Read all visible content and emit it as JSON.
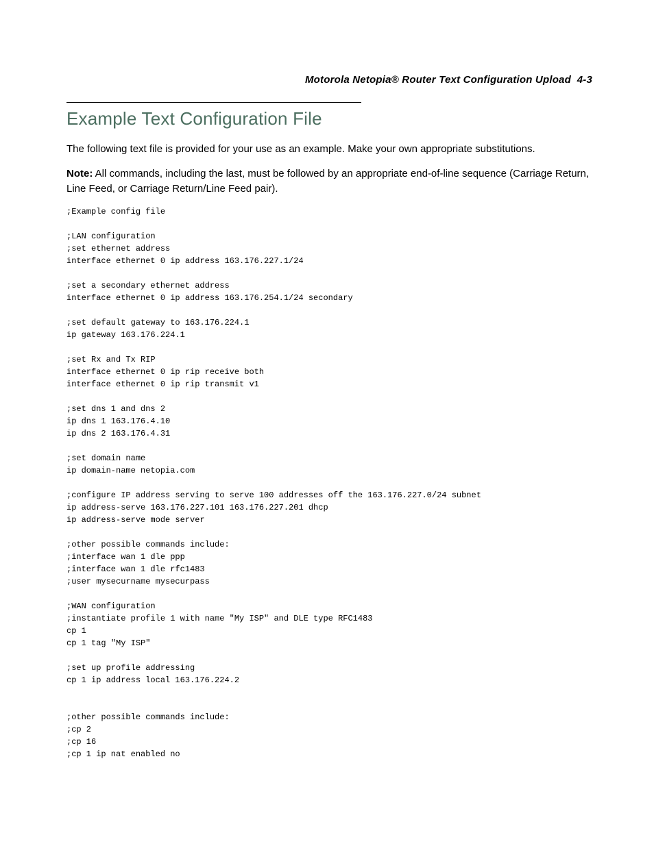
{
  "header": {
    "running_title": "Motorola Netopia® Router Text Configuration Upload",
    "page_label": "4-3"
  },
  "section": {
    "heading": "Example Text Configuration File",
    "intro": "The following text file is provided for your use as an example. Make your own appropriate substitutions.",
    "note_label": "Note:",
    "note_body": " All commands, including the last, must be followed by an appropriate end-of-line sequence (Carriage Return, Line Feed, or Carriage Return/Line Feed pair)."
  },
  "config_text": ";Example config file\n\n;LAN configuration\n;set ethernet address\ninterface ethernet 0 ip address 163.176.227.1/24\n\n;set a secondary ethernet address\ninterface ethernet 0 ip address 163.176.254.1/24 secondary\n\n;set default gateway to 163.176.224.1\nip gateway 163.176.224.1\n\n;set Rx and Tx RIP\ninterface ethernet 0 ip rip receive both\ninterface ethernet 0 ip rip transmit v1\n\n;set dns 1 and dns 2\nip dns 1 163.176.4.10\nip dns 2 163.176.4.31\n\n;set domain name\nip domain-name netopia.com\n\n;configure IP address serving to serve 100 addresses off the 163.176.227.0/24 subnet\nip address-serve 163.176.227.101 163.176.227.201 dhcp\nip address-serve mode server\n\n;other possible commands include:\n;interface wan 1 dle ppp\n;interface wan 1 dle rfc1483\n;user mysecurname mysecurpass\n\n;WAN configuration\n;instantiate profile 1 with name \"My ISP\" and DLE type RFC1483\ncp 1\ncp 1 tag \"My ISP\"\n\n;set up profile addressing\ncp 1 ip address local 163.176.224.2\n\n\n;other possible commands include:\n;cp 2\n;cp 16\n;cp 1 ip nat enabled no"
}
